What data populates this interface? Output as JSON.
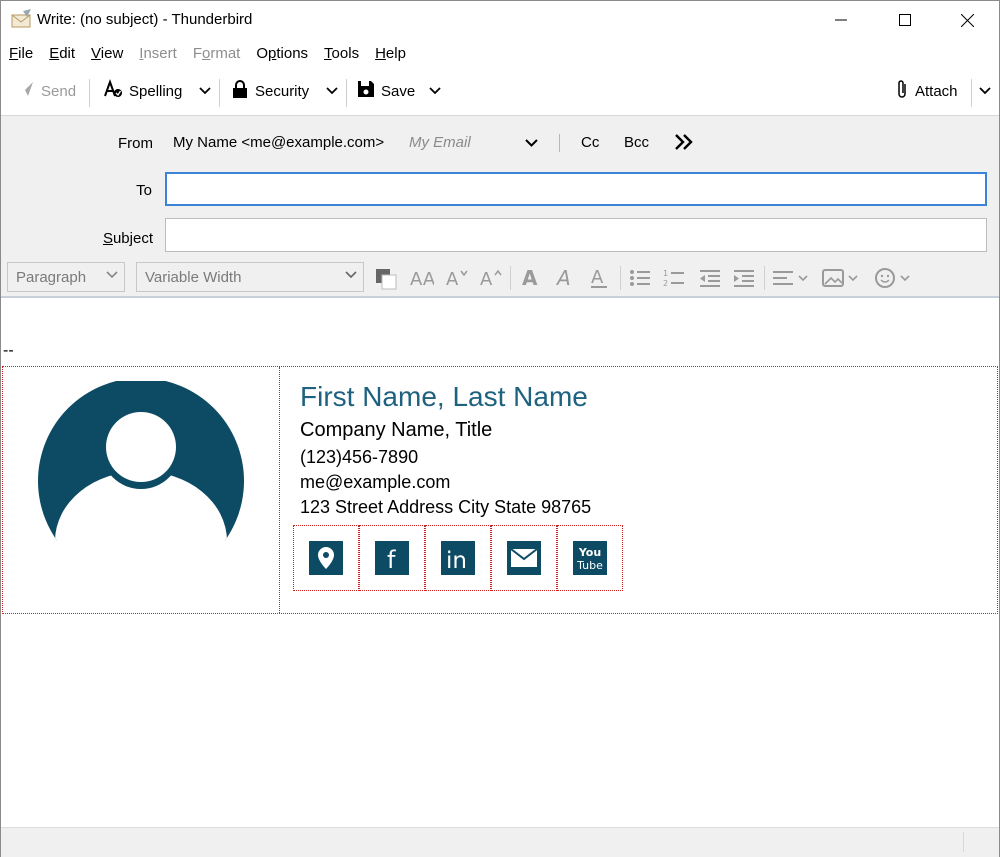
{
  "window": {
    "title": "Write: (no subject) - Thunderbird"
  },
  "menu": {
    "items": [
      {
        "label": "File",
        "accel": "F",
        "rest": "ile",
        "enabled": true
      },
      {
        "label": "Edit",
        "accel": "E",
        "rest": "dit",
        "enabled": true
      },
      {
        "label": "View",
        "accel": "V",
        "rest": "iew",
        "enabled": true
      },
      {
        "label": "Insert",
        "accel": "I",
        "rest": "nsert",
        "enabled": false
      },
      {
        "label": "Format",
        "accel": "o",
        "enabled": false
      },
      {
        "label": "Options",
        "accel": "p",
        "enabled": true
      },
      {
        "label": "Tools",
        "accel": "T",
        "rest": "ools",
        "enabled": true
      },
      {
        "label": "Help",
        "accel": "H",
        "rest": "elp",
        "enabled": true
      }
    ]
  },
  "toolbar": {
    "send": "Send",
    "spelling": "Spelling",
    "security": "Security",
    "save": "Save",
    "attach": "Attach"
  },
  "header": {
    "from_label": "From",
    "from_value": "My Name <me@example.com>",
    "from_hint": "My Email",
    "cc": "Cc",
    "bcc": "Bcc",
    "to_label": "To",
    "to_value": "",
    "subject_label": "Subject",
    "subject_value": ""
  },
  "format": {
    "paragraph": "Paragraph",
    "font": "Variable Width"
  },
  "body": {
    "separator": "--",
    "signature": {
      "name": "First Name, Last Name",
      "company": "Company Name, Title",
      "phone": "(123)456-7890",
      "email": "me@example.com",
      "address": "123 Street Address City State 98765",
      "social": [
        "map-pin-icon",
        "facebook-icon",
        "linkedin-icon",
        "email-icon",
        "youtube-icon"
      ],
      "youtube_text_1": "You",
      "youtube_text_2": "Tube"
    }
  },
  "colors": {
    "brand": "#0d4a63",
    "name": "#1e6280",
    "focus": "#3c82d6",
    "border_dotted": "#cc2222"
  }
}
